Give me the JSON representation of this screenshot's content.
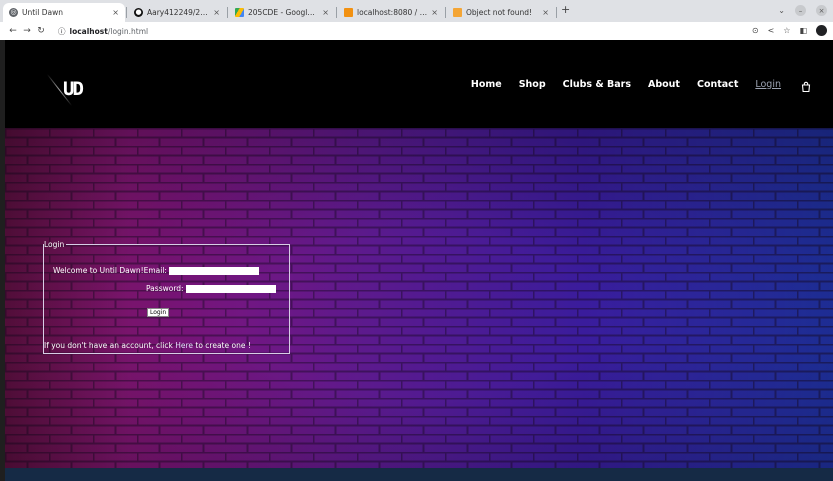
{
  "browser": {
    "tabs": [
      {
        "title": "Until Dawn",
        "active": true
      },
      {
        "title": "Aary412249/205CDE",
        "active": false
      },
      {
        "title": "205CDE - Google Drive",
        "active": false
      },
      {
        "title": "localhost:8080 / localhost",
        "active": false
      },
      {
        "title": "Object not found!",
        "active": false
      }
    ],
    "new_tab": "+",
    "address": {
      "host": "localhost",
      "path": "/login.html"
    }
  },
  "site": {
    "logo": "UD",
    "nav": [
      {
        "label": "Home"
      },
      {
        "label": "Shop"
      },
      {
        "label": "Clubs & Bars"
      },
      {
        "label": "About"
      },
      {
        "label": "Contact"
      },
      {
        "label": "Login"
      }
    ]
  },
  "login_form": {
    "legend": "Login",
    "welcome": "Welcome to Until Dawn!",
    "email_label": "Email:",
    "email_value": "",
    "password_label": "Password:",
    "password_value": "",
    "button": "Login",
    "signup_prefix": "If you don't have an account, click ",
    "signup_link": "Here",
    "signup_suffix": " to create one !"
  },
  "colors": {
    "header_bg": "#000000",
    "hero_left": "#9d1a6e",
    "hero_right": "#2438b8",
    "footer_bg": "#152a45"
  }
}
